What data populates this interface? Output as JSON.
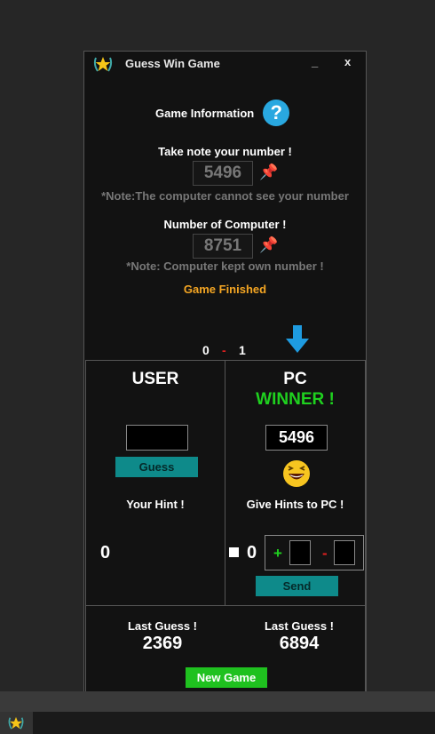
{
  "window": {
    "title": "Guess Win Game",
    "minimize_label": "_",
    "close_label": "x"
  },
  "info": {
    "label": "Game Information",
    "help_symbol": "?"
  },
  "user_number": {
    "label": "Take note your number !",
    "value": "5496",
    "note": "*Note:The computer cannot see your number"
  },
  "computer_number": {
    "label": "Number of Computer !",
    "value": "8751",
    "note": "*Note: Computer kept own number !"
  },
  "status": "Game Finished",
  "score": {
    "user": "0",
    "separator": "-",
    "pc": "1"
  },
  "user_panel": {
    "title": "USER",
    "guess_input": "",
    "guess_button": "Guess",
    "hint_label": "Your Hint !",
    "hint_value": "0"
  },
  "pc_panel": {
    "title": "PC",
    "winner_label": "WINNER !",
    "guess_value": "5496",
    "hint_label": "Give Hints to PC !",
    "hint_value": "0",
    "plus_symbol": "+",
    "minus_symbol": "-",
    "plus_input": "",
    "minus_input": "",
    "send_button": "Send"
  },
  "last_guess": {
    "user_label": "Last Guess !",
    "user_value": "2369",
    "pc_label": "Last Guess !",
    "pc_value": "6894"
  },
  "new_game_button": "New Game",
  "colors": {
    "status": "#f5a623",
    "winner": "#1fd11f",
    "teal_button": "#0e8a8a",
    "new_game": "#1fc11f",
    "help": "#29a8e0"
  },
  "icons": {
    "app": "laurel-star-icon",
    "help": "question-mark-icon",
    "pin": "pushpin-icon",
    "arrow": "down-arrow-icon",
    "smiley": "laughing-face-icon"
  }
}
